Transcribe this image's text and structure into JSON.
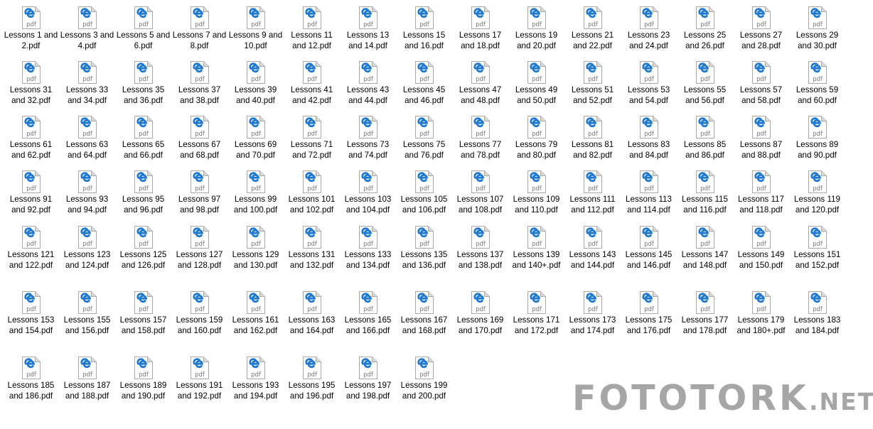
{
  "icon": {
    "name": "edge-pdf-file-icon",
    "badge_text": "pdf",
    "colors": {
      "page_fill": "#ffffff",
      "page_border": "#a9a9a9",
      "fold": "#d9d9d9",
      "edge_blue": "#1f79d0",
      "badge_text": "#777777"
    }
  },
  "files": [
    "Lessons 1 and 2.pdf",
    "Lessons 3 and 4.pdf",
    "Lessons 5 and 6.pdf",
    "Lessons 7 and 8.pdf",
    "Lessons 9 and 10.pdf",
    "Lessons 11 and 12.pdf",
    "Lessons 13 and 14.pdf",
    "Lessons 15 and 16.pdf",
    "Lessons 17 and 18.pdf",
    "Lessons 19 and 20.pdf",
    "Lessons 21 and 22.pdf",
    "Lessons 23 and 24.pdf",
    "Lessons 25 and 26.pdf",
    "Lessons 27 and 28.pdf",
    "Lessons 29 and 30.pdf",
    "Lessons 31 and 32.pdf",
    "Lessons 33 and 34.pdf",
    "Lessons 35 and 36.pdf",
    "Lessons 37 and 38.pdf",
    "Lessons 39 and 40.pdf",
    "Lessons 41 and 42.pdf",
    "Lessons 43 and 44.pdf",
    "Lessons 45 and 46.pdf",
    "Lessons 47 and 48.pdf",
    "Lessons 49 and 50.pdf",
    "Lessons 51 and 52.pdf",
    "Lessons 53 and 54.pdf",
    "Lessons 55 and 56.pdf",
    "Lessons 57 and 58.pdf",
    "Lessons 59 and 60.pdf",
    "Lessons 61 and 62.pdf",
    "Lessons 63 and 64.pdf",
    "Lessons 65 and 66.pdf",
    "Lessons 67 and 68.pdf",
    "Lessons 69 and 70.pdf",
    "Lessons 71 and 72.pdf",
    "Lessons 73 and 74.pdf",
    "Lessons 75 and 76.pdf",
    "Lessons 77 and 78.pdf",
    "Lessons 79 and 80.pdf",
    "Lessons 81 and 82.pdf",
    "Lessons 83 and 84.pdf",
    "Lessons 85 and 86.pdf",
    "Lessons 87 and 88.pdf",
    "Lessons 89 and 90.pdf",
    "Lessons 91 and 92.pdf",
    "Lessons 93 and 94.pdf",
    "Lessons 95 and 96.pdf",
    "Lessons 97 and 98.pdf",
    "Lessons 99 and 100.pdf",
    "Lessons 101 and 102.pdf",
    "Lessons 103 and 104.pdf",
    "Lessons 105 and 106.pdf",
    "Lessons 107 and 108.pdf",
    "Lessons 109 and 110.pdf",
    "Lessons 111 and 112.pdf",
    "Lessons 113 and 114.pdf",
    "Lessons 115 and 116.pdf",
    "Lessons 117 and 118.pdf",
    "Lessons 119 and 120.pdf",
    "Lessons 121 and 122.pdf",
    "Lessons 123 and 124.pdf",
    "Lessons 125 and 126.pdf",
    "Lessons 127 and 128.pdf",
    "Lessons 129 and 130.pdf",
    "Lessons 131 and 132.pdf",
    "Lessons 133 and 134.pdf",
    "Lessons 135 and 136.pdf",
    "Lessons 137 and 138.pdf",
    "Lessons 139 and 140+.pdf",
    "Lessons 143 and 144.pdf",
    "Lessons 145 and 146.pdf",
    "Lessons 147 and 148.pdf",
    "Lessons 149 and 150.pdf",
    "Lessons 151 and 152.pdf",
    "Lessons 153 and 154.pdf",
    "Lessons 155 and 156.pdf",
    "Lessons 157 and 158.pdf",
    "Lessons 159 and 160.pdf",
    "Lessons 161 and 162.pdf",
    "Lessons 163 and 164.pdf",
    "Lessons 165 and 166.pdf",
    "Lessons 167 and 168.pdf",
    "Lessons 169 and 170.pdf",
    "Lessons 171 and 172.pdf",
    "Lessons 173 and 174.pdf",
    "Lessons 175 and 176.pdf",
    "Lessons 177 and 178.pdf",
    "Lessons 179 and 180+.pdf",
    "Lessons 183 and 184.pdf",
    "Lessons 185 and 186.pdf",
    "Lessons 187 and 188.pdf",
    "Lessons 189 and 190.pdf",
    "Lessons 191 and 192.pdf",
    "Lessons 193 and 194.pdf",
    "Lessons 195 and 196.pdf",
    "Lessons 197 and 198.pdf",
    "Lessons 199 and 200.pdf"
  ],
  "watermark": {
    "main": "FOTOTORK",
    "tld": ".NET",
    "color": "#a6a6a6"
  }
}
